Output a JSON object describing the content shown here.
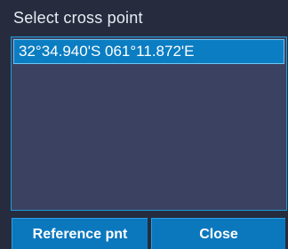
{
  "dialog": {
    "title": "Select cross point",
    "items": [
      {
        "label": "32°34.940'S 061°11.872'E",
        "selected": true
      }
    ],
    "buttons": {
      "reference": "Reference pnt",
      "close": "Close"
    }
  },
  "colors": {
    "background": "#262c3e",
    "list_background": "#3b4261",
    "selection": "#0b7dc2",
    "button": "#0b78be",
    "border_accent": "#1e9ad8"
  }
}
